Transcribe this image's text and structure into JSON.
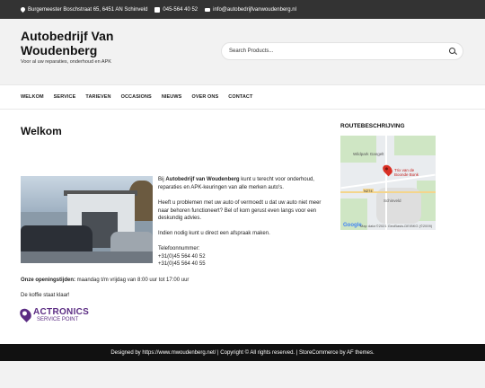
{
  "topbar": {
    "address": "Burgemeester Boschstraat 65, 6451 AN Schinveld",
    "phone": "045-564 40 52",
    "email": "info@autobedrijfvanwoudenberg.nl"
  },
  "header": {
    "title": "Autobedrijf Van Woudenberg",
    "tagline": "Voor al uw reparaties, onderhoud en APK",
    "search_placeholder": "Search Products..."
  },
  "nav": {
    "items": [
      "WELKOM",
      "SERVICE",
      "TARIEVEN",
      "OCCASIONS",
      "NIEUWS",
      "OVER ONS",
      "CONTACT"
    ]
  },
  "main": {
    "title": "Welkom",
    "intro_prefix": "Bij ",
    "intro_company": "Autobedrijf van Woudenberg",
    "intro_rest": " kunt u terecht voor onderhoud, reparaties en APK-keuringen van alle merken auto's.",
    "problem_text": "Heeft u problemen met uw auto of vermoedt u dat uw auto niet meer naar behoren functioneert? Bel of kom gerust even langs voor een deskundig advies.",
    "appointment_text": "Indien nodig kunt u direct een afspraak maken.",
    "phone_label": "Telefoonnummer:",
    "phone_1": "+31(0)45 564 40 52",
    "phone_2": "+31(0)45 564 40 55",
    "hours_label": "Onze openingstijden:",
    "hours_value": " maandag t/m vrijdag van 8:00 uur tot 17:00 uur",
    "coffee_text": "De koffie staat klaar!",
    "partner_brand": "ACTRONICS",
    "partner_sub": "SERVICE POINT"
  },
  "sidebar": {
    "widget_title": "ROUTEBESCHRIJVING",
    "map": {
      "label_wildpark": "Wildpark Gangelt",
      "label_business": "Trix van de Boonde Bonk",
      "label_town": "Schinveld",
      "road_shield": "N274",
      "google": "Google",
      "attribution": "Map data ©2021 GeoBasis-DE/BKG (©2009)"
    }
  },
  "footer": {
    "text": "Designed by https://www.mwoudenberg.net/ | Copyright © All rights reserved. | StoreCommerce by AF themes."
  }
}
